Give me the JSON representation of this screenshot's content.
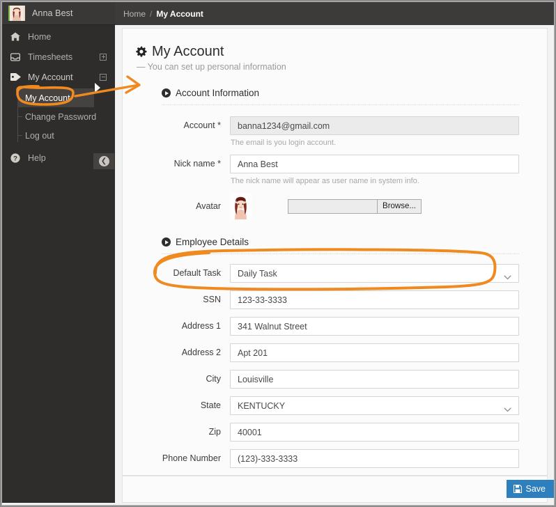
{
  "sidebar": {
    "brand": {
      "name": "Anna Best",
      "avatar_icon": "user-avatar"
    },
    "items": [
      {
        "label": "Home",
        "icon": "home-icon",
        "expander": ""
      },
      {
        "label": "Timesheets",
        "icon": "inbox-icon",
        "expander": "plus"
      },
      {
        "label": "My Account",
        "icon": "tag-icon",
        "expander": "minus"
      }
    ],
    "submenu": [
      {
        "label": "My Account",
        "selected": true
      },
      {
        "label": "Change Password",
        "selected": false
      },
      {
        "label": "Log out",
        "selected": false
      }
    ],
    "help": {
      "label": "Help",
      "icon": "question-circle-icon",
      "expander": "plus"
    },
    "collapse": {
      "icon": "arrow-circle-left-icon"
    }
  },
  "topbar": {
    "breadcrumb_home": "Home",
    "breadcrumb_sep": "/",
    "breadcrumb_current": "My Account"
  },
  "page": {
    "title": "My Account",
    "title_icon": "gear-icon",
    "subtitle": "— You can set up personal information"
  },
  "sections": {
    "account_information": {
      "heading": "Account Information",
      "heading_icon": "caret-circle-right-icon",
      "fields": {
        "account": {
          "label": "Account *",
          "value": "banna1234@gmail.com",
          "hint": "The email is you login account.",
          "readonly": true
        },
        "nick_name": {
          "label": "Nick name *",
          "value": "Anna Best",
          "hint": "The nick name will appear as user name in system info.",
          "readonly": false
        },
        "avatar": {
          "label": "Avatar",
          "file_value": "",
          "browse_label": "Browse..."
        }
      }
    },
    "employee_details": {
      "heading": "Employee Details",
      "heading_icon": "caret-circle-right-icon",
      "fields": [
        {
          "label": "Default Task",
          "value": "Daily Task",
          "type": "select",
          "name": "default-task"
        },
        {
          "label": "SSN",
          "value": "123-33-3333",
          "type": "text",
          "name": "ssn"
        },
        {
          "label": "Address 1",
          "value": "341 Walnut Street",
          "type": "text",
          "name": "address-1"
        },
        {
          "label": "Address 2",
          "value": "Apt 201",
          "type": "text",
          "name": "address-2"
        },
        {
          "label": "City",
          "value": "Louisville",
          "type": "text",
          "name": "city"
        },
        {
          "label": "State",
          "value": "KENTUCKY",
          "type": "select",
          "name": "state"
        },
        {
          "label": "Zip",
          "value": "40001",
          "type": "text",
          "name": "zip"
        },
        {
          "label": "Phone Number",
          "value": "(123)-333-3333",
          "type": "text",
          "name": "phone-number"
        }
      ]
    }
  },
  "footer": {
    "save_label": "Save",
    "save_icon": "floppy-disk-icon"
  },
  "annotations": {
    "color": "#ef8a21",
    "highlight_menu_item": "My Account",
    "highlight_field": "Default Task",
    "arrow": "points from My Account menu item to the right"
  }
}
